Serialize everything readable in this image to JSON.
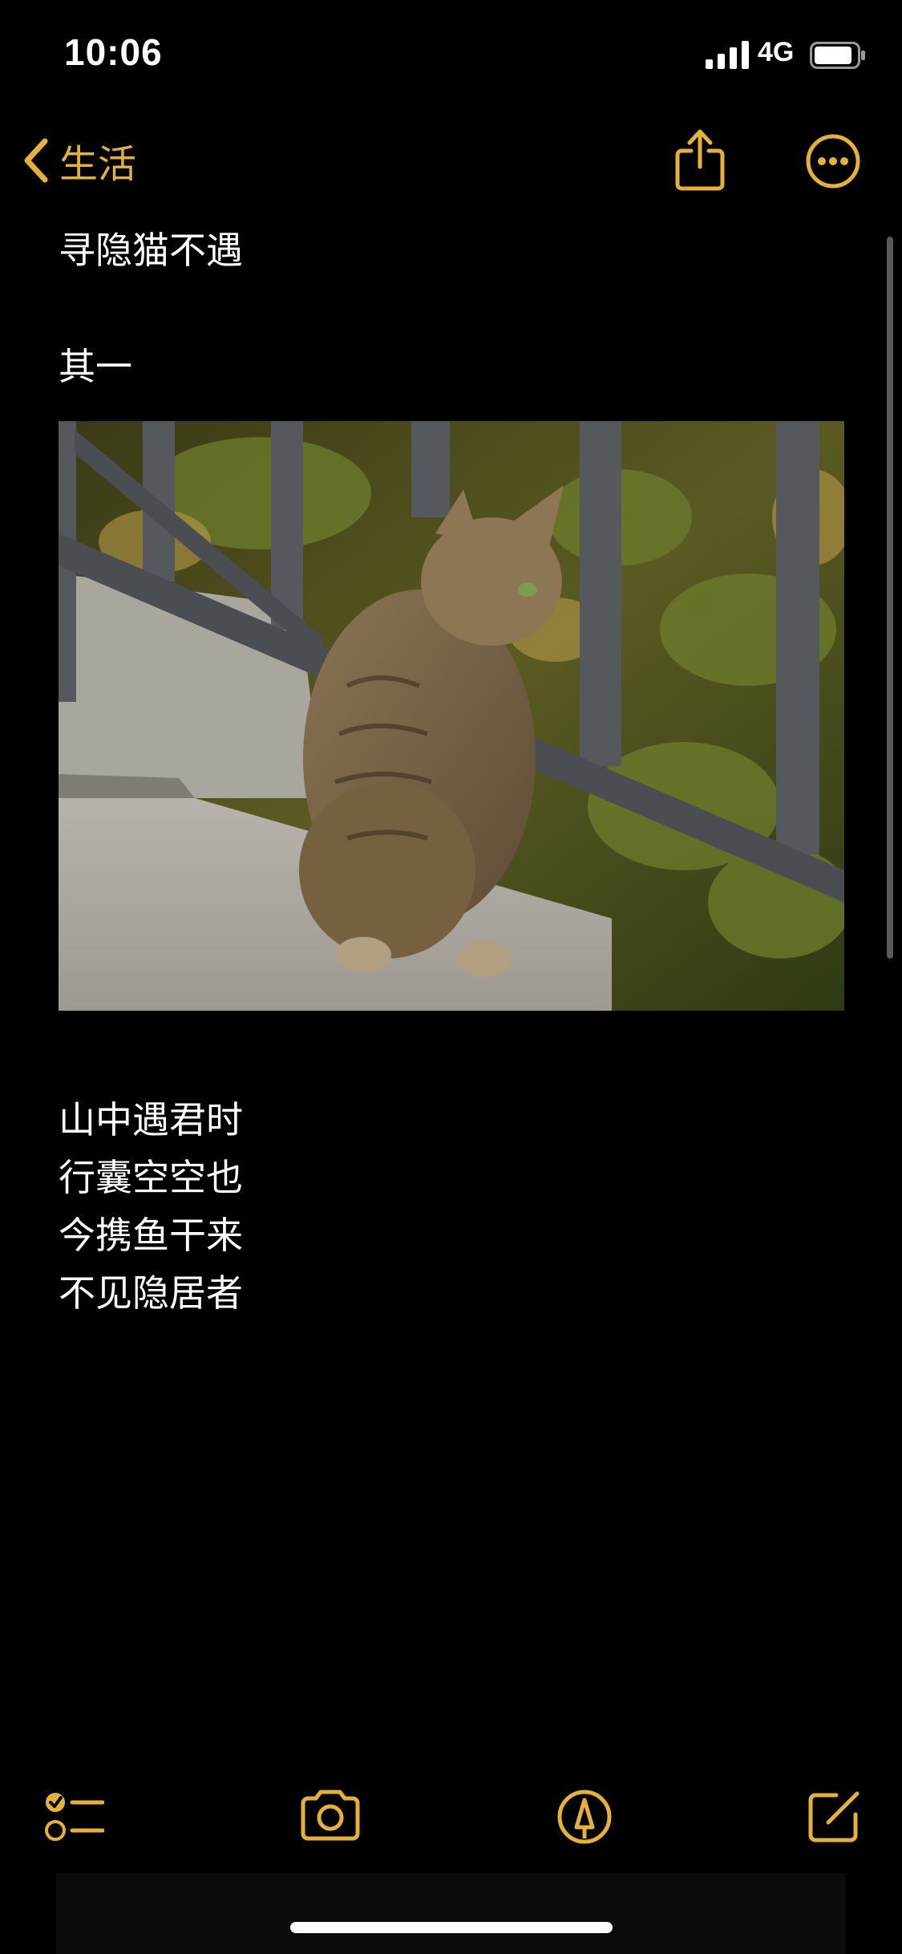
{
  "status": {
    "time": "10:06",
    "network": "4G"
  },
  "nav": {
    "back_label": "生活"
  },
  "note": {
    "title": "寻隐猫不遇",
    "subtitle": "其一",
    "poem_lines": [
      "山中遇君时",
      "行囊空空也",
      "今携鱼干来",
      "不见隐居者"
    ]
  },
  "colors": {
    "accent": "#e5b13a",
    "background": "#000000",
    "text": "#ffffff"
  },
  "icons": {
    "back": "chevron-left-icon",
    "share": "share-icon",
    "more": "ellipsis-circle-icon",
    "checklist": "checklist-icon",
    "camera": "camera-icon",
    "markup": "pen-circle-icon",
    "compose": "compose-icon"
  }
}
